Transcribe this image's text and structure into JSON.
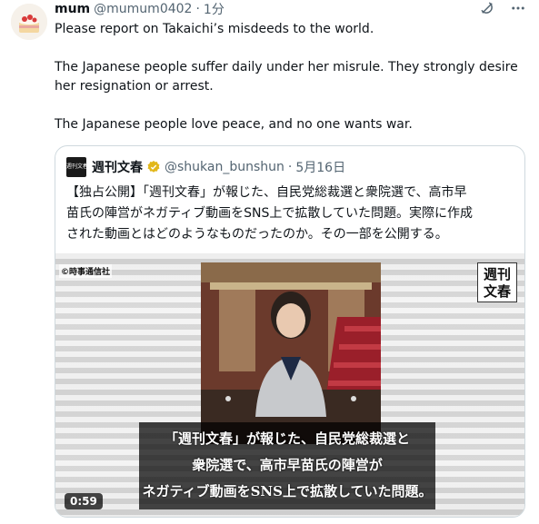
{
  "post": {
    "author_name": "mum",
    "author_handle": "@mumum0402",
    "separator": "·",
    "time": "1分",
    "avatar_icon": "cake-avatar",
    "body": [
      "Please report on Takaichi’s misdeeds to the world.",
      "The Japanese people suffer daily under her misrule. They strongly desire her resignation or arrest.",
      "The Japanese people love peace, and no one wants war."
    ],
    "header_icons": [
      "grok-icon",
      "more-icon"
    ]
  },
  "quote": {
    "logo_text": "週刊文春",
    "author_name": "週刊文春",
    "author_handle": "@shukan_bunshun",
    "separator": "·",
    "date": "5月16日",
    "verified_color": "#e2b719",
    "text_lines": [
      "【独占公開】「週刊文春」が報じた、自民党総裁選と衆院選で、高市早",
      "苗氏の陣営がネガティブ動画をSNS上で拡散していた問題。実際に作成",
      "された動画とはどのようなものだったのか。その一部を公開する。"
    ],
    "media": {
      "credit": "©時事通信社",
      "logo_lines": [
        "週刊",
        "文春"
      ],
      "subtitle_lines": [
        "「週刊文春」が報じた、自民党総裁選と",
        "衆院選で、高市早苗氏の陣営が",
        "ネガティブ動画をSNS上で拡散していた問題。"
      ],
      "duration": "0:59"
    }
  }
}
